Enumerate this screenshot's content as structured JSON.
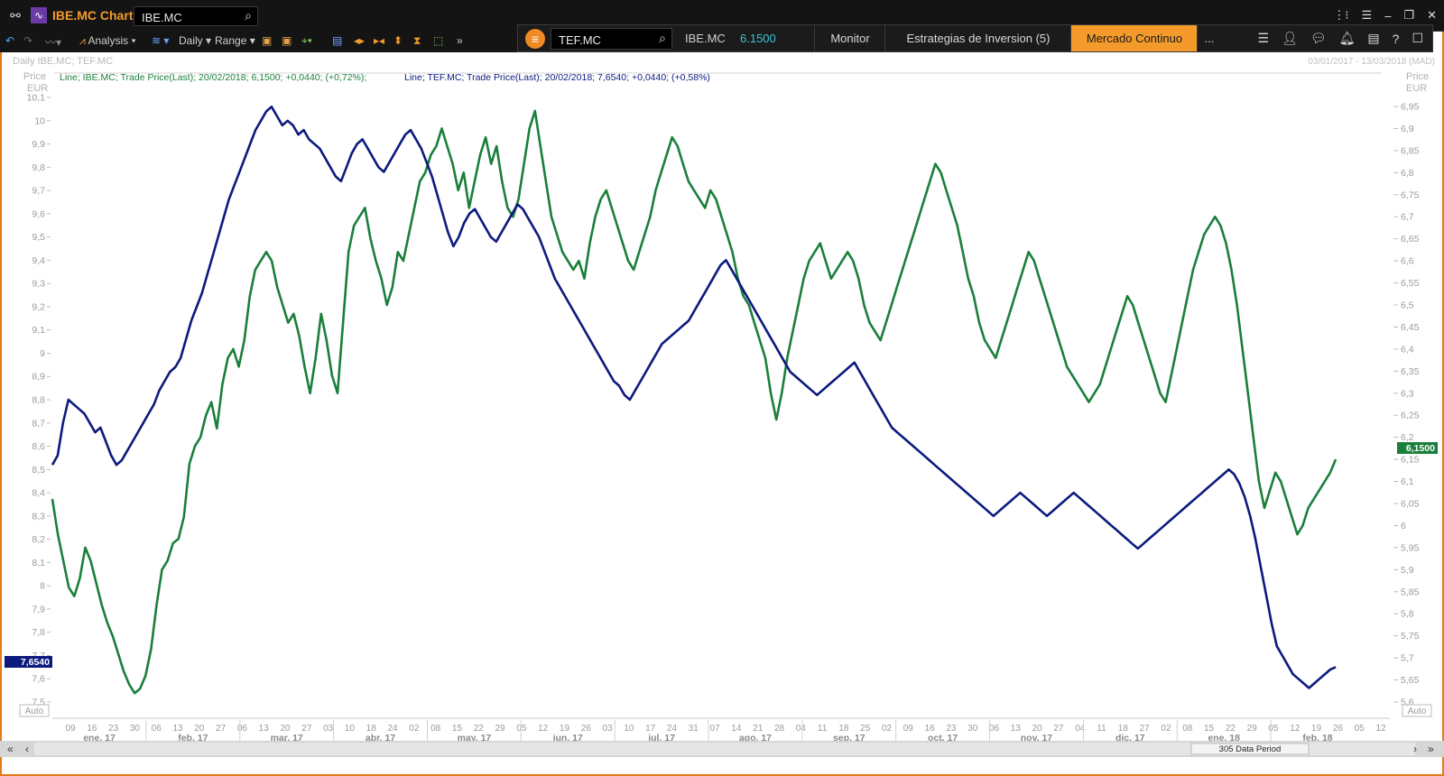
{
  "topbar": {
    "app_title": "IBE.MC Chart",
    "ric_input": "IBE.MC",
    "icons": [
      "link-icon",
      "chart-icon",
      "search-icon",
      "tree-icon",
      "menu-icon",
      "minimize-icon",
      "restore-icon",
      "close-icon"
    ]
  },
  "panel": {
    "search_value": "TEF.MC",
    "ric": "IBE.MC",
    "price": "6.1500",
    "tabs": [
      "Monitor",
      "Estrategias de Inversion (5)",
      "Mercado Continuo",
      "..."
    ],
    "active_tab": "Mercado Continuo"
  },
  "toolbar": {
    "analysis": "Analysis",
    "interval": "Daily",
    "range": "Range"
  },
  "header": {
    "title": "Daily IBE.MC; TEF.MC",
    "date_range": "03/01/2017 - 13/03/2018 (MAD)",
    "left_axis_title": "Price",
    "left_axis_unit": "EUR",
    "right_axis_title": "Price",
    "right_axis_unit": "EUR",
    "legend_ibe": "Line; IBE.MC; Trade Price(Last); 20/02/2018; 6,1500; +0,0440; (+0,72%);",
    "legend_tef": "Line; TEF.MC; Trade Price(Last); 20/02/2018; 7,6540; +0,0440; (+0,58%)",
    "left_price_tag": "7,6540",
    "right_price_tag": "6,1500",
    "auto_left": "Auto",
    "auto_right": "Auto",
    "data_period": "305 Data Period"
  },
  "colors": {
    "ibe": "#1a7f3b",
    "tef": "#0c1a7e",
    "accent": "#f39a2b"
  },
  "chart_data": {
    "type": "line",
    "left_axis": {
      "min": 7.5,
      "max": 10.1,
      "ticks": [
        "10,1",
        "10",
        "9,9",
        "9,8",
        "9,7",
        "9,6",
        "9,5",
        "9,4",
        "9,3",
        "9,2",
        "9,1",
        "9",
        "8,9",
        "8,8",
        "8,7",
        "8,6",
        "8,5",
        "8,4",
        "8,3",
        "8,2",
        "8,1",
        "8",
        "7,9",
        "7,8",
        "7,7",
        "7,6",
        "7,5"
      ]
    },
    "right_axis": {
      "min": 5.6,
      "max": 6.95,
      "ticks": [
        "6,95",
        "6,9",
        "6,85",
        "6,8",
        "6,75",
        "6,7",
        "6,65",
        "6,6",
        "6,55",
        "6,5",
        "6,45",
        "6,4",
        "6,35",
        "6,3",
        "6,25",
        "6,2",
        "6,15",
        "6,1",
        "6,05",
        "6",
        "5,95",
        "5,9",
        "5,85",
        "5,8",
        "5,75",
        "5,7",
        "5,65",
        "5,6"
      ]
    },
    "x_day_labels": [
      "09",
      "16",
      "23",
      "30",
      "06",
      "13",
      "20",
      "27",
      "06",
      "13",
      "20",
      "27",
      "03",
      "10",
      "18",
      "24",
      "02",
      "08",
      "15",
      "22",
      "29",
      "05",
      "12",
      "19",
      "26",
      "03",
      "10",
      "17",
      "24",
      "31",
      "07",
      "14",
      "21",
      "28",
      "04",
      "11",
      "18",
      "25",
      "02",
      "09",
      "16",
      "23",
      "30",
      "06",
      "13",
      "20",
      "27",
      "04",
      "11",
      "18",
      "27",
      "02",
      "08",
      "15",
      "22",
      "29",
      "05",
      "12",
      "19",
      "26",
      "05",
      "12"
    ],
    "x_month_labels": [
      "ene. 17",
      "feb. 17",
      "mar. 17",
      "abr. 17",
      "may. 17",
      "jun. 17",
      "jul. 17",
      "ago. 17",
      "sep. 17",
      "oct. 17",
      "nov. 17",
      "dic. 17",
      "ene. 18",
      "feb. 18"
    ],
    "series": [
      {
        "name": "IBE.MC",
        "axis": "right",
        "values": [
          6.06,
          5.98,
          5.92,
          5.86,
          5.84,
          5.88,
          5.95,
          5.92,
          5.87,
          5.82,
          5.78,
          5.75,
          5.71,
          5.67,
          5.64,
          5.62,
          5.63,
          5.66,
          5.72,
          5.82,
          5.9,
          5.92,
          5.96,
          5.97,
          6.02,
          6.14,
          6.18,
          6.2,
          6.25,
          6.28,
          6.22,
          6.32,
          6.38,
          6.4,
          6.36,
          6.42,
          6.52,
          6.58,
          6.6,
          6.62,
          6.6,
          6.54,
          6.5,
          6.46,
          6.48,
          6.43,
          6.36,
          6.3,
          6.38,
          6.48,
          6.42,
          6.34,
          6.3,
          6.46,
          6.62,
          6.68,
          6.7,
          6.72,
          6.65,
          6.6,
          6.56,
          6.5,
          6.54,
          6.62,
          6.6,
          6.66,
          6.72,
          6.78,
          6.8,
          6.84,
          6.86,
          6.9,
          6.86,
          6.82,
          6.76,
          6.8,
          6.72,
          6.78,
          6.84,
          6.88,
          6.82,
          6.86,
          6.78,
          6.72,
          6.7,
          6.74,
          6.82,
          6.9,
          6.94,
          6.86,
          6.78,
          6.7,
          6.66,
          6.62,
          6.6,
          6.58,
          6.6,
          6.56,
          6.64,
          6.7,
          6.74,
          6.76,
          6.72,
          6.68,
          6.64,
          6.6,
          6.58,
          6.62,
          6.66,
          6.7,
          6.76,
          6.8,
          6.84,
          6.88,
          6.86,
          6.82,
          6.78,
          6.76,
          6.74,
          6.72,
          6.76,
          6.74,
          6.7,
          6.66,
          6.62,
          6.56,
          6.52,
          6.5,
          6.46,
          6.42,
          6.38,
          6.3,
          6.24,
          6.3,
          6.38,
          6.44,
          6.5,
          6.56,
          6.6,
          6.62,
          6.64,
          6.6,
          6.56,
          6.58,
          6.6,
          6.62,
          6.6,
          6.56,
          6.5,
          6.46,
          6.44,
          6.42,
          6.46,
          6.5,
          6.54,
          6.58,
          6.62,
          6.66,
          6.7,
          6.74,
          6.78,
          6.82,
          6.8,
          6.76,
          6.72,
          6.68,
          6.62,
          6.56,
          6.52,
          6.46,
          6.42,
          6.4,
          6.38,
          6.42,
          6.46,
          6.5,
          6.54,
          6.58,
          6.62,
          6.6,
          6.56,
          6.52,
          6.48,
          6.44,
          6.4,
          6.36,
          6.34,
          6.32,
          6.3,
          6.28,
          6.3,
          6.32,
          6.36,
          6.4,
          6.44,
          6.48,
          6.52,
          6.5,
          6.46,
          6.42,
          6.38,
          6.34,
          6.3,
          6.28,
          6.34,
          6.4,
          6.46,
          6.52,
          6.58,
          6.62,
          6.66,
          6.68,
          6.7,
          6.68,
          6.64,
          6.58,
          6.5,
          6.4,
          6.3,
          6.2,
          6.1,
          6.04,
          6.08,
          6.12,
          6.1,
          6.06,
          6.02,
          5.98,
          6.0,
          6.04,
          6.06,
          6.08,
          6.1,
          6.12,
          6.15
        ]
      },
      {
        "name": "TEF.MC",
        "axis": "left",
        "values": [
          8.52,
          8.56,
          8.7,
          8.8,
          8.78,
          8.76,
          8.74,
          8.7,
          8.66,
          8.68,
          8.62,
          8.56,
          8.52,
          8.54,
          8.58,
          8.62,
          8.66,
          8.7,
          8.74,
          8.78,
          8.84,
          8.88,
          8.92,
          8.94,
          8.98,
          9.06,
          9.14,
          9.2,
          9.26,
          9.34,
          9.42,
          9.5,
          9.58,
          9.66,
          9.72,
          9.78,
          9.84,
          9.9,
          9.96,
          10.0,
          10.04,
          10.06,
          10.02,
          9.98,
          10.0,
          9.98,
          9.94,
          9.96,
          9.92,
          9.9,
          9.88,
          9.84,
          9.8,
          9.76,
          9.74,
          9.8,
          9.86,
          9.9,
          9.92,
          9.88,
          9.84,
          9.8,
          9.78,
          9.82,
          9.86,
          9.9,
          9.94,
          9.96,
          9.92,
          9.88,
          9.82,
          9.76,
          9.68,
          9.6,
          9.52,
          9.46,
          9.5,
          9.56,
          9.6,
          9.62,
          9.58,
          9.54,
          9.5,
          9.48,
          9.52,
          9.56,
          9.6,
          9.64,
          9.62,
          9.58,
          9.54,
          9.5,
          9.44,
          9.38,
          9.32,
          9.28,
          9.24,
          9.2,
          9.16,
          9.12,
          9.08,
          9.04,
          9.0,
          8.96,
          8.92,
          8.88,
          8.86,
          8.82,
          8.8,
          8.84,
          8.88,
          8.92,
          8.96,
          9.0,
          9.04,
          9.06,
          9.08,
          9.1,
          9.12,
          9.14,
          9.18,
          9.22,
          9.26,
          9.3,
          9.34,
          9.38,
          9.4,
          9.36,
          9.32,
          9.28,
          9.24,
          9.2,
          9.16,
          9.12,
          9.08,
          9.04,
          9.0,
          8.96,
          8.92,
          8.9,
          8.88,
          8.86,
          8.84,
          8.82,
          8.84,
          8.86,
          8.88,
          8.9,
          8.92,
          8.94,
          8.96,
          8.92,
          8.88,
          8.84,
          8.8,
          8.76,
          8.72,
          8.68,
          8.66,
          8.64,
          8.62,
          8.6,
          8.58,
          8.56,
          8.54,
          8.52,
          8.5,
          8.48,
          8.46,
          8.44,
          8.42,
          8.4,
          8.38,
          8.36,
          8.34,
          8.32,
          8.3,
          8.32,
          8.34,
          8.36,
          8.38,
          8.4,
          8.38,
          8.36,
          8.34,
          8.32,
          8.3,
          8.32,
          8.34,
          8.36,
          8.38,
          8.4,
          8.38,
          8.36,
          8.34,
          8.32,
          8.3,
          8.28,
          8.26,
          8.24,
          8.22,
          8.2,
          8.18,
          8.16,
          8.18,
          8.2,
          8.22,
          8.24,
          8.26,
          8.28,
          8.3,
          8.32,
          8.34,
          8.36,
          8.38,
          8.4,
          8.42,
          8.44,
          8.46,
          8.48,
          8.5,
          8.48,
          8.44,
          8.38,
          8.3,
          8.2,
          8.08,
          7.96,
          7.84,
          7.74,
          7.7,
          7.66,
          7.62,
          7.6,
          7.58,
          7.56,
          7.58,
          7.6,
          7.62,
          7.64,
          7.65
        ]
      }
    ]
  }
}
